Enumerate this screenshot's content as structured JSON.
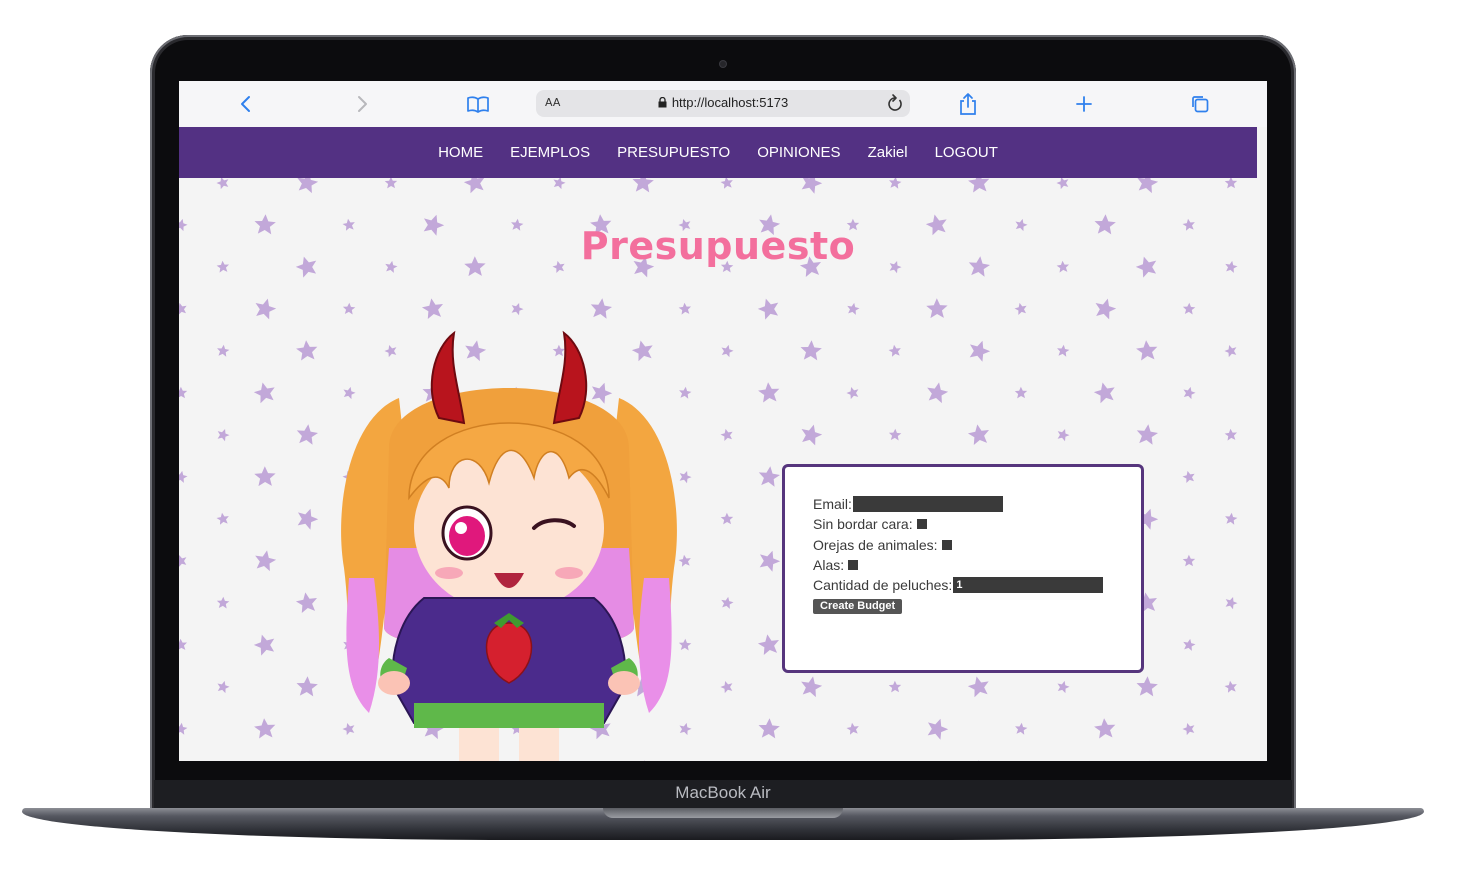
{
  "device": {
    "model_label": "MacBook Air"
  },
  "browser": {
    "text_size_label": "AA",
    "url": "http://localhost:5173"
  },
  "nav": {
    "items": [
      "HOME",
      "EJEMPLOS",
      "PRESUPUESTO",
      "OPINIONES",
      "Zakiel",
      "LOGOUT"
    ]
  },
  "page": {
    "title": "Presupuesto"
  },
  "form": {
    "email_label": "Email:",
    "email_value": "",
    "sin_bordar_label": "Sin bordar cara:",
    "orejas_label": "Orejas de animales:",
    "alas_label": "Alas:",
    "cantidad_label": "Cantidad de peluches:",
    "cantidad_value": "1",
    "submit_label": "Create Budget"
  },
  "colors": {
    "nav_bg": "#533183",
    "title": "#f36f9d",
    "star": "#c2a8d9",
    "card_border": "#56357d"
  }
}
